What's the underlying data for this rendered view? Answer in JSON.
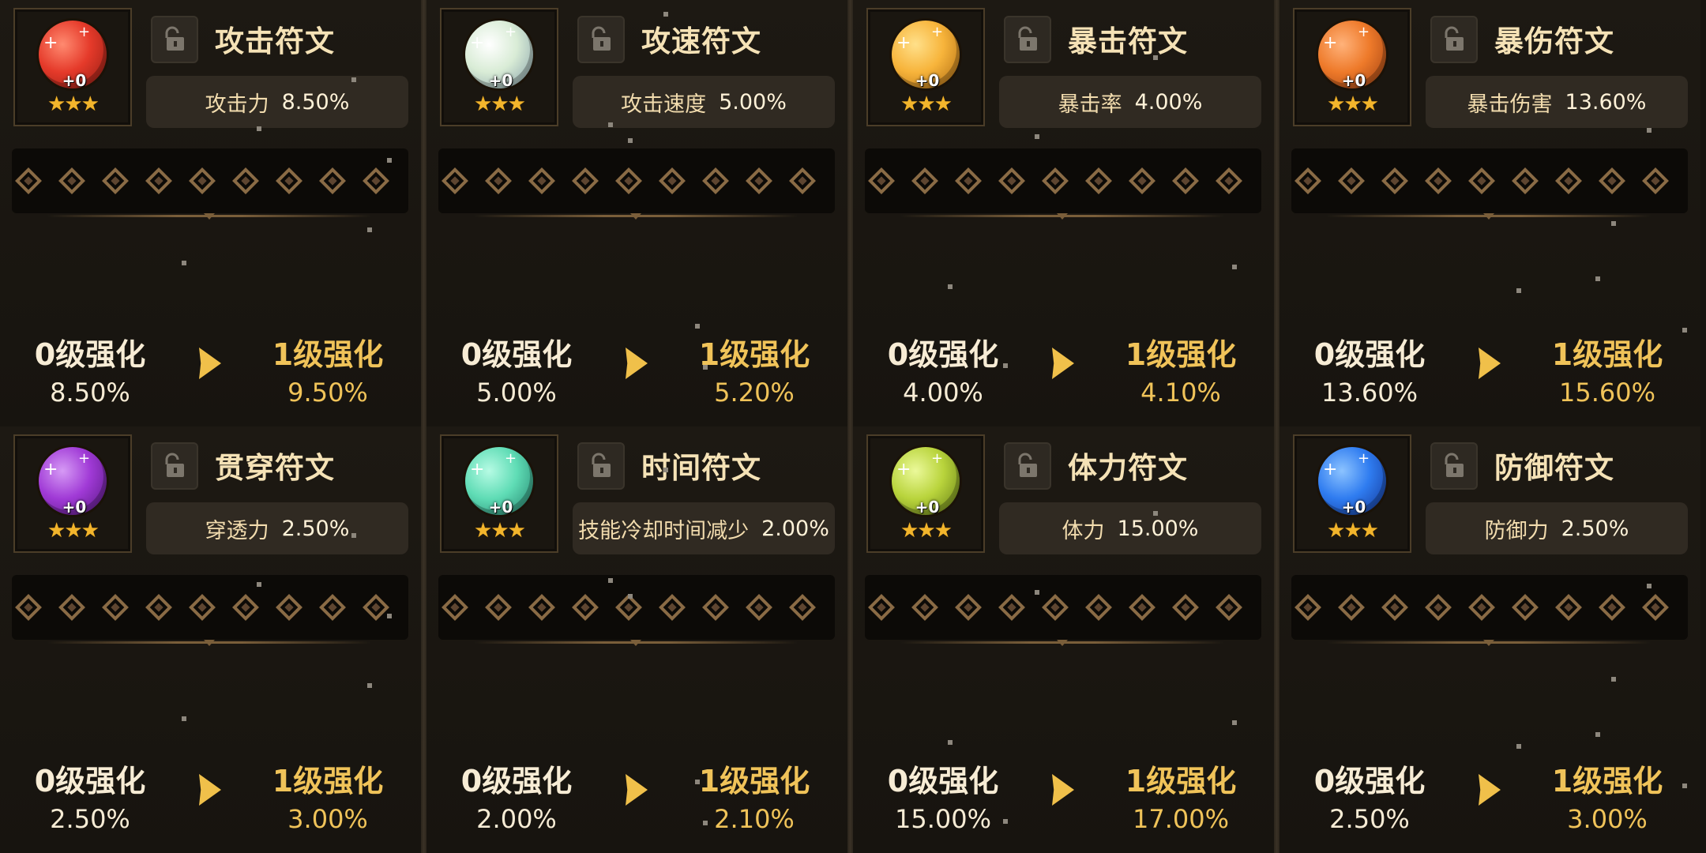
{
  "runes": [
    {
      "name": "攻击符文",
      "stat_label": "攻击力",
      "stat_value": "8.50%",
      "gem_level": "+0",
      "stars": "★★★",
      "current_level": "0级强化",
      "current_value": "8.50%",
      "next_level": "1级强化",
      "next_value": "9.50%",
      "gem_color": "#e53a2a",
      "gem_dark": "#8e1b12",
      "gem_light": "#ff8a70"
    },
    {
      "name": "攻速符文",
      "stat_label": "攻击速度",
      "stat_value": "5.00%",
      "gem_level": "+0",
      "stars": "★★★",
      "current_level": "0级强化",
      "current_value": "5.00%",
      "next_level": "1级强化",
      "next_value": "5.20%",
      "gem_color": "#d9ecd6",
      "gem_dark": "#7f9aa6",
      "gem_light": "#ffffff"
    },
    {
      "name": "暴击符文",
      "stat_label": "暴击率",
      "stat_value": "4.00%",
      "gem_level": "+0",
      "stars": "★★★",
      "current_level": "0级强化",
      "current_value": "4.00%",
      "next_level": "1级强化",
      "next_value": "4.10%",
      "gem_color": "#f7b43b",
      "gem_dark": "#a8640e",
      "gem_light": "#ffe08a"
    },
    {
      "name": "暴伤符文",
      "stat_label": "暴击伤害",
      "stat_value": "13.60%",
      "gem_level": "+0",
      "stars": "★★★",
      "current_level": "0级强化",
      "current_value": "13.60%",
      "next_level": "1级强化",
      "next_value": "15.60%",
      "gem_color": "#ee7a2a",
      "gem_dark": "#9a3c10",
      "gem_light": "#ffb27a"
    },
    {
      "name": "贯穿符文",
      "stat_label": "穿透力",
      "stat_value": "2.50%",
      "gem_level": "+0",
      "stars": "★★★",
      "current_level": "0级强化",
      "current_value": "2.50%",
      "next_level": "1级强化",
      "next_value": "3.00%",
      "gem_color": "#a03ad6",
      "gem_dark": "#51157a",
      "gem_light": "#d69af5"
    },
    {
      "name": "时间符文",
      "stat_label": "技能冷却时间减少",
      "stat_value": "2.00%",
      "gem_level": "+0",
      "stars": "★★★",
      "current_level": "0级强化",
      "current_value": "2.00%",
      "next_level": "1级强化",
      "next_value": "2.10%",
      "gem_color": "#5fdcb5",
      "gem_dark": "#1f7c68",
      "gem_light": "#b6fbe4"
    },
    {
      "name": "体力符文",
      "stat_label": "体力",
      "stat_value": "15.00%",
      "gem_level": "+0",
      "stars": "★★★",
      "current_level": "0级强化",
      "current_value": "15.00%",
      "next_level": "1级强化",
      "next_value": "17.00%",
      "gem_color": "#b9d43c",
      "gem_dark": "#5d7612",
      "gem_light": "#ebf99a"
    },
    {
      "name": "防御符文",
      "stat_label": "防御力",
      "stat_value": "2.50%",
      "gem_level": "+0",
      "stars": "★★★",
      "current_level": "0级强化",
      "current_value": "2.50%",
      "next_level": "1级强化",
      "next_value": "3.00%",
      "gem_color": "#2f7cf0",
      "gem_dark": "#12318f",
      "gem_light": "#8cc3ff"
    }
  ],
  "slot_count": 9
}
